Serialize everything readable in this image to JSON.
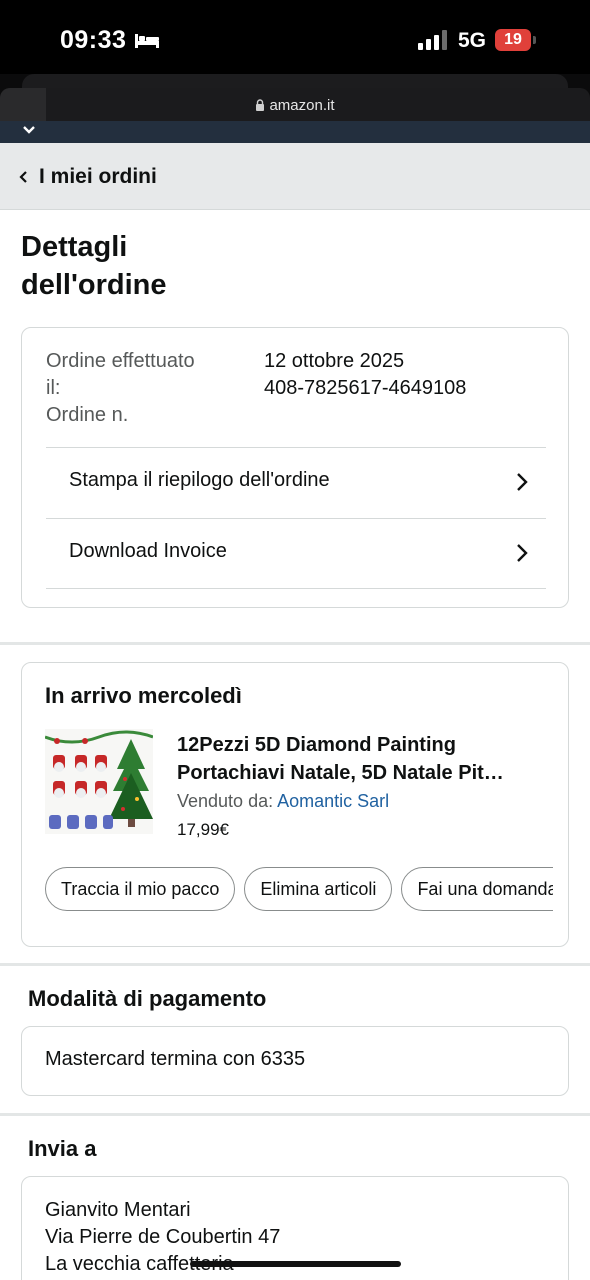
{
  "status_bar": {
    "time": "09:33",
    "network": "5G",
    "battery": "19",
    "icons": [
      "bed-icon",
      "signal-icon",
      "battery-icon"
    ]
  },
  "browser": {
    "url": "amazon.it"
  },
  "breadcrumb": {
    "label": "I miei ordini"
  },
  "page": {
    "title_line1": "Dettagli",
    "title_line2": "dell'ordine"
  },
  "order_summary": {
    "placed_label_line1": "Ordine effettuato",
    "placed_label_line2": "il:",
    "number_label": "Ordine n.",
    "placed_date": "12 ottobre 2025",
    "order_number": "408-7825617-4649108",
    "actions": [
      {
        "label": "Stampa il riepilogo dell'ordine"
      },
      {
        "label": "Download Invoice"
      }
    ]
  },
  "shipment": {
    "heading": "In arrivo mercoledì",
    "product": {
      "title_line1": "12Pezzi 5D Diamond Painting",
      "title_line2": "Portachiavi Natale, 5D Natale Pit…",
      "sold_by_label": "Venduto da: ",
      "seller": "Aomantic Sarl",
      "price": "17,99€"
    },
    "buttons": [
      {
        "label": "Traccia il mio pacco"
      },
      {
        "label": "Elimina articoli"
      },
      {
        "label": "Fai una domanda"
      }
    ]
  },
  "payment": {
    "heading": "Modalità di pagamento",
    "method": "Mastercard  termina con 6335"
  },
  "shipping_address": {
    "heading": "Invia a",
    "name": "Gianvito Mentari",
    "street": "Via Pierre de Coubertin 47",
    "extra": "La vecchia caffetteria"
  },
  "colors": {
    "header_navy": "#232f3e",
    "link_blue": "#2162a1",
    "breadcrumb_bg": "#e7e9ea",
    "battery_red": "#e0403a"
  }
}
